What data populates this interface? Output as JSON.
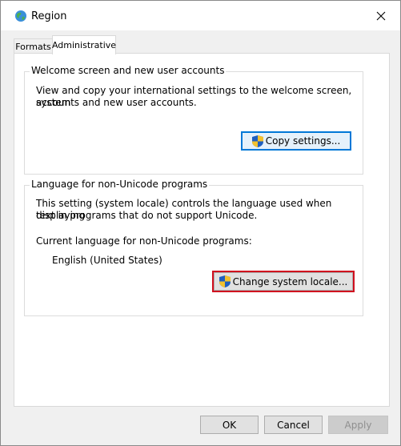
{
  "window": {
    "title": "Region",
    "close_label": "✕"
  },
  "tabs": [
    {
      "label": "Formats",
      "active": false
    },
    {
      "label": "Administrative",
      "active": true
    }
  ],
  "welcome_group": {
    "title": "Welcome screen and new user accounts",
    "description_line1": "View and copy your international settings to the welcome screen, system",
    "description_line2": "accounts and new user accounts.",
    "copy_button": "Copy settings..."
  },
  "non_unicode_group": {
    "title": "Language for non-Unicode programs",
    "description_line1": "This setting (system locale) controls the language used when displaying",
    "description_line2": "text in programs that do not support Unicode.",
    "current_label": "Current language for non-Unicode programs:",
    "current_value": "English (United States)",
    "change_button": "Change system locale..."
  },
  "footer": {
    "ok": "OK",
    "cancel": "Cancel",
    "apply": "Apply"
  },
  "colors": {
    "accent": "#0078d7",
    "highlight": "#d00f1f",
    "shield_blue": "#1f5fbf",
    "shield_yellow": "#f2c12e"
  },
  "icons": {
    "title": "globe-icon",
    "buttons": "uac-shield-icon"
  }
}
